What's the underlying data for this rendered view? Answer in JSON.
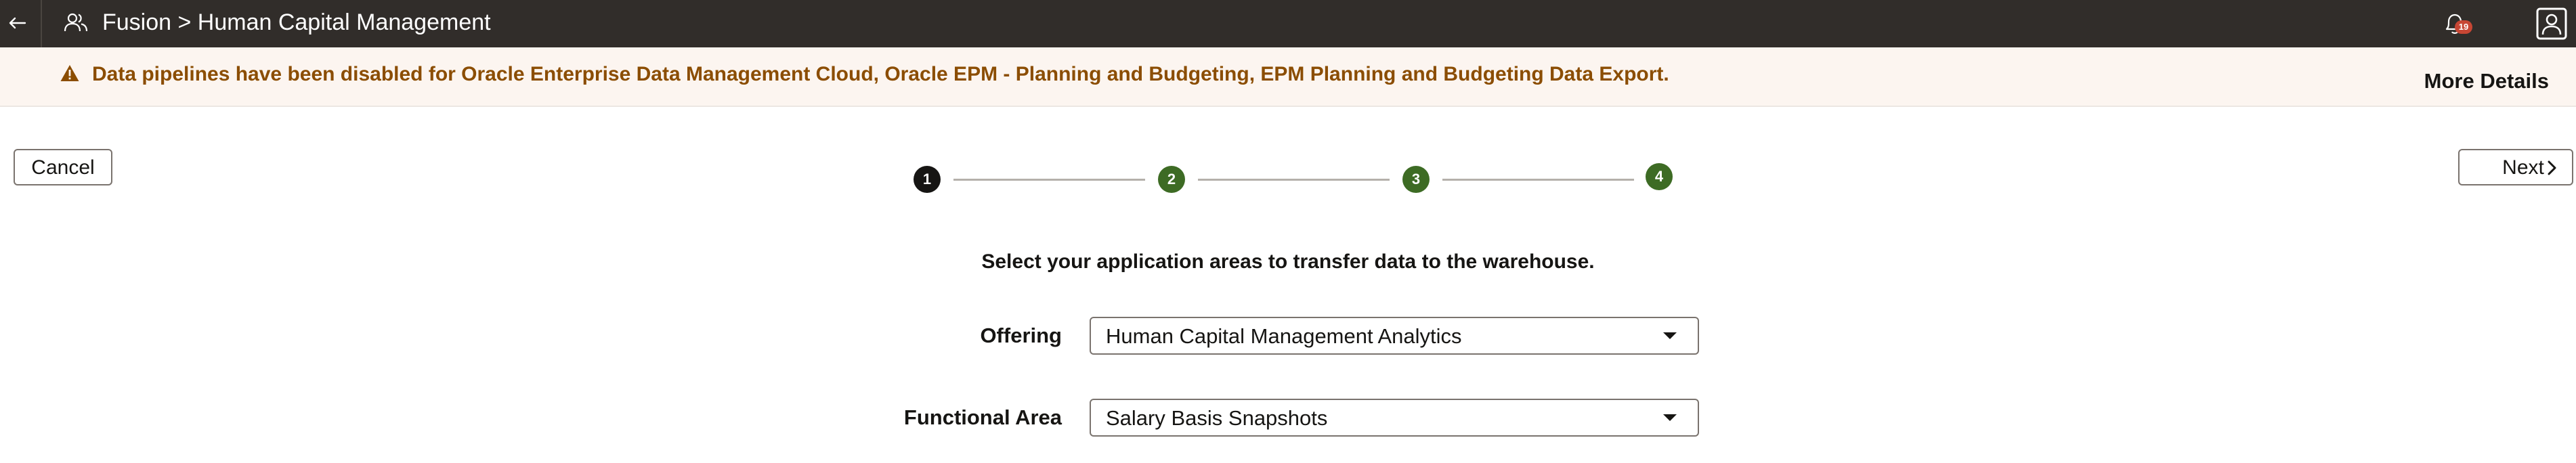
{
  "topbar": {
    "back_icon": "arrow-left-icon",
    "app_icon": "people-icon",
    "title": "Fusion > Human Capital Management",
    "notifications_count": "19",
    "notifications_icon": "bell-icon",
    "user_icon": "user-profile-icon"
  },
  "banner": {
    "icon": "warning-icon",
    "message": "Data pipelines have been disabled for Oracle Enterprise Data Management Cloud, Oracle EPM - Planning and Budgeting, EPM Planning and Budgeting Data Export.",
    "more_details": "More Details"
  },
  "actions": {
    "cancel": "Cancel",
    "next": "Next"
  },
  "stepper": {
    "steps": [
      {
        "label": "1",
        "state": "current"
      },
      {
        "label": "2",
        "state": "completed"
      },
      {
        "label": "3",
        "state": "completed"
      },
      {
        "label": "4",
        "state": "completed"
      }
    ]
  },
  "form": {
    "instruction": "Select your application areas to transfer data to the warehouse.",
    "offering": {
      "label": "Offering",
      "value": "Human Capital Management Analytics"
    },
    "functional_area": {
      "label": "Functional Area",
      "value": "Salary Basis Snapshots"
    }
  },
  "colors": {
    "topbar": "#312d2a",
    "banner_bg": "#fcf5f0",
    "warning_text": "#8b4d02",
    "step_current": "#161513",
    "step_completed": "#3d6b24"
  }
}
